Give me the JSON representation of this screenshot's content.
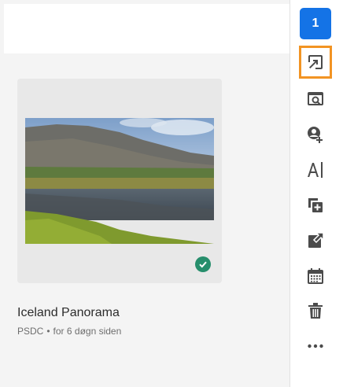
{
  "rail": {
    "badge_count": "1",
    "buttons": [
      {
        "name": "link-icon"
      },
      {
        "name": "preview-icon"
      },
      {
        "name": "add-user-icon"
      },
      {
        "name": "text-icon"
      },
      {
        "name": "duplicate-icon"
      },
      {
        "name": "export-icon"
      },
      {
        "name": "calendar-icon"
      },
      {
        "name": "trash-icon"
      },
      {
        "name": "more-icon"
      }
    ]
  },
  "asset": {
    "title": "Iceland Panorama",
    "type": "PSDC",
    "separator": "•",
    "modified": "for 6 døgn siden",
    "synced": true
  },
  "colors": {
    "accent": "#1473e6",
    "highlight": "#f29423",
    "success": "#268e6c"
  }
}
